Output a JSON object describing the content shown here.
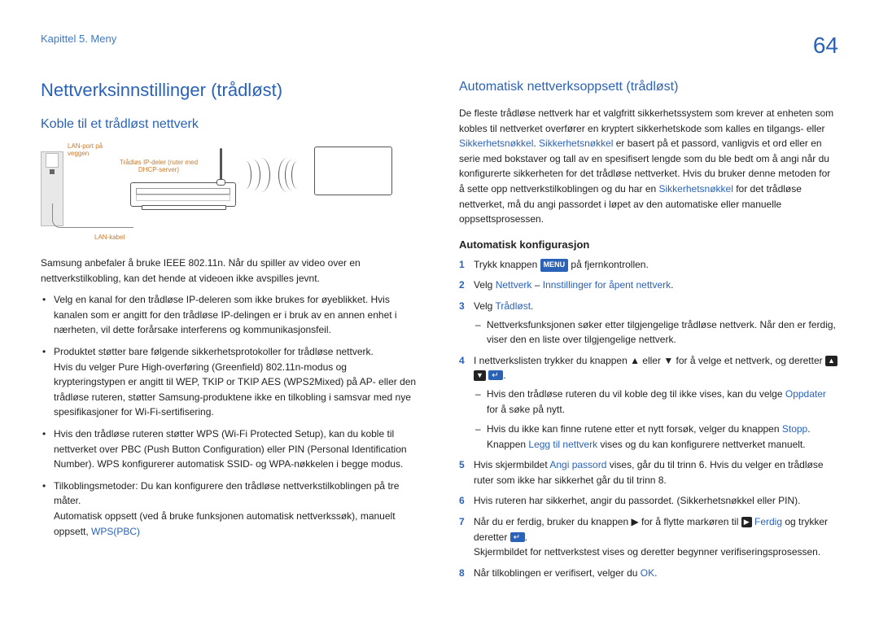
{
  "header": {
    "chapter": "Kapittel 5. Meny",
    "page": "64"
  },
  "left": {
    "h1": "Nettverksinnstillinger (trådløst)",
    "h2": "Koble til et trådløst nettverk",
    "diagram": {
      "lan_port": "LAN-port på veggen",
      "router": "Trådløs IP-deler (ruter med DHCP-server)",
      "cable": "LAN-kabel"
    },
    "intro": "Samsung anbefaler å bruke IEEE 802.11n. Når du spiller av video over en nettverkstilkobling, kan det hende at videoen ikke avspilles jevnt.",
    "bullets": {
      "b1": "Velg en kanal for den trådløse IP-deleren som ikke brukes for øyeblikket. Hvis kanalen som er angitt for den trådløse IP-delingen er i bruk av en annen enhet i nærheten, vil dette forårsake interferens og kommunikasjonsfeil.",
      "b2a": "Produktet støtter bare følgende sikkerhetsprotokoller for trådløse nettverk.",
      "b2b": "Hvis du velger Pure High-overføring (Greenfield) 802.11n-modus og krypteringstypen er angitt til WEP, TKIP or TKIP AES (WPS2Mixed) på AP- eller den trådløse ruteren, støtter Samsung-produktene ikke en tilkobling i samsvar med nye spesifikasjoner for Wi-Fi-sertifisering.",
      "b3": "Hvis den trådløse ruteren støtter WPS (Wi-Fi Protected Setup), kan du koble til nettverket over PBC (Push Button Configuration) eller PIN (Personal Identification Number). WPS konfigurerer automatisk SSID- og WPA-nøkkelen i begge modus.",
      "b4a": "Tilkoblingsmetoder: Du kan konfigurere den trådløse nettverkstilkoblingen på tre måter.",
      "b4b": "Automatisk oppsett (ved å bruke funksjonen automatisk nettverkssøk), manuelt oppsett, ",
      "b4c": "WPS(PBC)"
    }
  },
  "right": {
    "h2": "Automatisk nettverksoppsett (trådløst)",
    "p1a": "De fleste trådløse nettverk har et valgfritt sikkerhetssystem som krever at enheten som kobles til nettverket overfører en kryptert sikkerhetskode som kalles en tilgangs- eller ",
    "p1b": "Sikkerhetsnøkkel",
    "p1c": ". ",
    "p1d": "Sikkerhetsnøkkel",
    "p1e": " er basert på et passord, vanligvis et ord eller en serie med bokstaver og tall av en spesifisert lengde som du ble bedt om å angi når du konfigurerte sikkerheten for det trådløse nettverket. Hvis du bruker denne metoden for å sette opp nettverkstilkoblingen og du har en ",
    "p1f": "Sikkerhetsnøkkel",
    "p1g": " for det trådløse nettverket, må du angi passordet i løpet av den automatiske eller manuelle oppsettsprosessen.",
    "h3": "Automatisk konfigurasjon",
    "steps": {
      "s1a": "Trykk knappen ",
      "s1_menu": "MENU",
      "s1b": " på fjernkontrollen.",
      "s2a": "Velg ",
      "s2b": "Nettverk",
      "s2c": " – ",
      "s2d": "Innstillinger for åpent nettverk",
      "s2e": ".",
      "s3a": "Velg ",
      "s3b": "Trådløst",
      "s3c": ".",
      "s3_sub1": "Nettverksfunksjonen søker etter tilgjengelige trådløse nettverk. Når den er ferdig, viser den en liste over tilgjengelige nettverk.",
      "s4": "I nettverkslisten trykker du knappen ▲ eller ▼ for å velge et nettverk, og deretter ",
      "s4_end": ".",
      "s4_sub1a": "Hvis den trådløse ruteren du vil koble deg til ikke vises, kan du velge ",
      "s4_sub1b": "Oppdater",
      "s4_sub1c": " for å søke på nytt.",
      "s4_sub2a": "Hvis du ikke kan finne rutene etter et nytt forsøk, velger du knappen ",
      "s4_sub2b": "Stopp",
      "s4_sub2c": ".",
      "s4_sub2d": "Knappen ",
      "s4_sub2e": "Legg til nettverk",
      "s4_sub2f": " vises og du kan konfigurere nettverket manuelt.",
      "s5a": "Hvis skjermbildet ",
      "s5b": "Angi passord",
      "s5c": " vises, går du til trinn 6. Hvis du velger en trådløse ruter som ikke har sikkerhet går du til trinn 8.",
      "s6": "Hvis ruteren har sikkerhet, angir du passordet. (Sikkerhetsnøkkel eller PIN).",
      "s7a": "Når du er ferdig, bruker du knappen ▶ for å flytte markøren til ",
      "s7b": "Ferdig",
      "s7c": " og trykker deretter ",
      "s7d": ".",
      "s7e": "Skjermbildet for nettverkstest vises og deretter begynner verifiseringsprosessen.",
      "s8a": "Når tilkoblingen er verifisert, velger du ",
      "s8b": "OK",
      "s8c": "."
    }
  }
}
